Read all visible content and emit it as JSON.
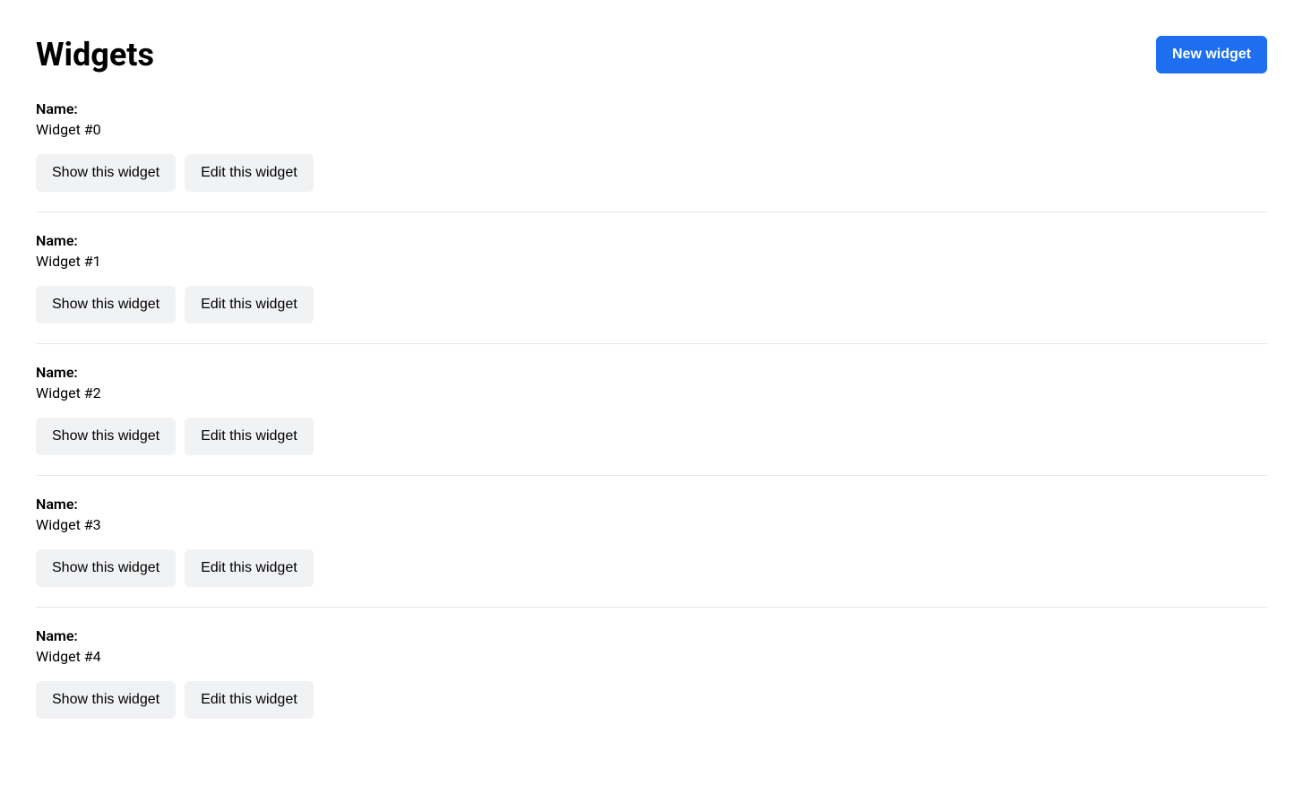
{
  "header": {
    "title": "Widgets",
    "new_button_label": "New widget"
  },
  "labels": {
    "name_label": "Name:",
    "show_button": "Show this widget",
    "edit_button": "Edit this widget"
  },
  "widgets": [
    {
      "name": "Widget #0"
    },
    {
      "name": "Widget #1"
    },
    {
      "name": "Widget #2"
    },
    {
      "name": "Widget #3"
    },
    {
      "name": "Widget #4"
    }
  ]
}
